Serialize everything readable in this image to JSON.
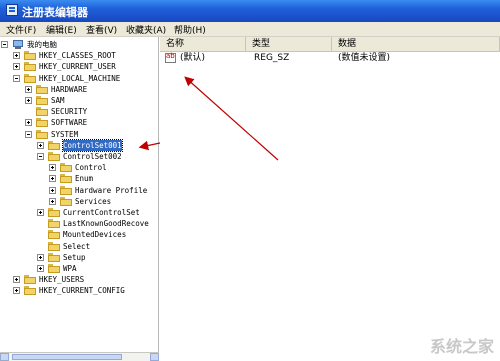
{
  "window": {
    "title": "注册表编辑器"
  },
  "menu": [
    "文件(F)",
    "编辑(E)",
    "查看(V)",
    "收藏夹(A)",
    "帮助(H)"
  ],
  "list": {
    "headers": [
      "名称",
      "类型",
      "数据"
    ],
    "rows": [
      {
        "name": "(默认)",
        "type": "REG_SZ",
        "data": "(数值未设置)"
      }
    ]
  },
  "tree": [
    {
      "label": "我的电脑",
      "icon": "computer",
      "expander": "minus"
    },
    {
      "label": "HKEY_CLASSES_ROOT",
      "icon": "folder",
      "expander": "plus"
    },
    {
      "label": "HKEY_CURRENT_USER",
      "icon": "folder",
      "expander": "plus"
    },
    {
      "label": "HKEY_LOCAL_MACHINE",
      "icon": "folder",
      "expander": "minus"
    },
    {
      "label": "HARDWARE",
      "icon": "folder",
      "expander": "plus"
    },
    {
      "label": "SAM",
      "icon": "folder",
      "expander": "plus"
    },
    {
      "label": "SECURITY",
      "icon": "folder",
      "expander": "none"
    },
    {
      "label": "SOFTWARE",
      "icon": "folder",
      "expander": "plus"
    },
    {
      "label": "SYSTEM",
      "icon": "folder",
      "expander": "minus"
    },
    {
      "label": "ControlSet001",
      "icon": "folder",
      "expander": "plus",
      "selected": true
    },
    {
      "label": "ControlSet002",
      "icon": "folder",
      "expander": "minus"
    },
    {
      "label": "Control",
      "icon": "folder",
      "expander": "plus"
    },
    {
      "label": "Enum",
      "icon": "folder",
      "expander": "plus"
    },
    {
      "label": "Hardware Profile",
      "icon": "folder",
      "expander": "plus"
    },
    {
      "label": "Services",
      "icon": "folder",
      "expander": "plus"
    },
    {
      "label": "CurrentControlSet",
      "icon": "folder",
      "expander": "plus"
    },
    {
      "label": "LastKnownGoodRecove",
      "icon": "folder",
      "expander": "none"
    },
    {
      "label": "MountedDevices",
      "icon": "folder",
      "expander": "none"
    },
    {
      "label": "Select",
      "icon": "folder",
      "expander": "none"
    },
    {
      "label": "Setup",
      "icon": "folder",
      "expander": "plus"
    },
    {
      "label": "WPA",
      "icon": "folder",
      "expander": "plus"
    },
    {
      "label": "HKEY_USERS",
      "icon": "folder",
      "expander": "plus"
    },
    {
      "label": "HKEY_CURRENT_CONFIG",
      "icon": "folder",
      "expander": "plus"
    }
  ],
  "annotation_color": "#c00000",
  "watermark": "系统之家"
}
